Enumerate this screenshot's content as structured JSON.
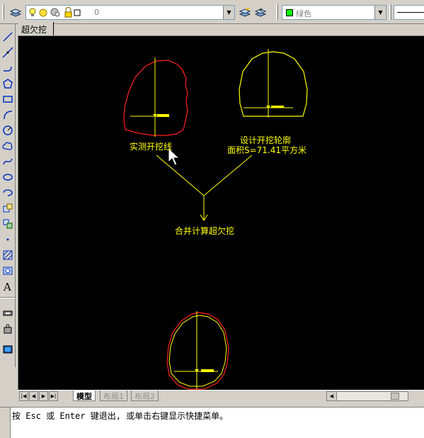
{
  "toolbar": {
    "layer_value": "0",
    "color_value": "绿色",
    "color_swatch": "#00ff00"
  },
  "document": {
    "tab_title": "超欠挖"
  },
  "drawing": {
    "label_measured": "实测开挖线",
    "label_design": "设计开挖轮廓",
    "label_area": "面积S=71.41平方米",
    "label_merge": "合并计算超欠挖",
    "colors": {
      "background": "#000000",
      "annotation": "#ffff00",
      "measured_line": "#ff0000",
      "design_line": "#ffff00"
    }
  },
  "tabs": {
    "model": "模型",
    "layout1": "布局1",
    "layout2": "布局2"
  },
  "command_line": {
    "prompt": "按 Esc 或 Enter 键退出, 或单击右键显示快捷菜单。"
  },
  "icons": [
    "layers-icon",
    "lightbulb-icon",
    "sun-icon",
    "layer-freeze-icon",
    "lock-icon",
    "line-icon",
    "polyline-icon",
    "polygon-icon",
    "rectangle-icon",
    "arc-icon",
    "circle-icon",
    "revcloud-icon",
    "spline-icon",
    "ellipse-icon",
    "insert-block-icon",
    "point-icon",
    "hatch-icon",
    "region-icon",
    "text-icon",
    "pointer-cursor-icon"
  ]
}
